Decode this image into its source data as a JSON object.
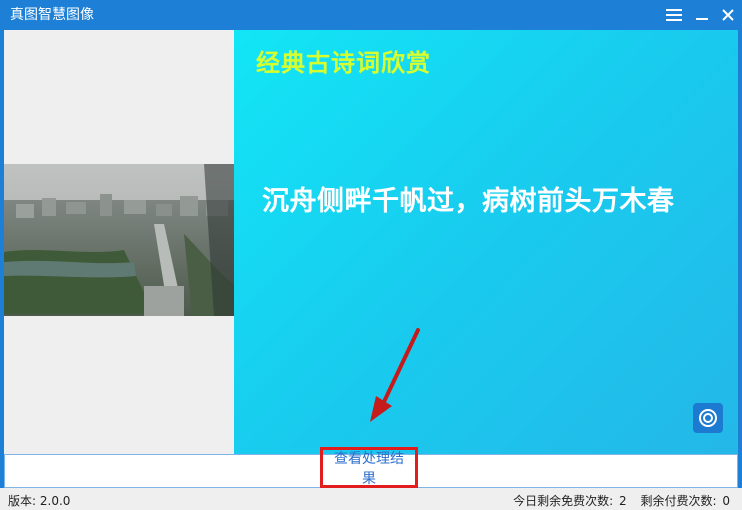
{
  "app": {
    "title": "真图智慧图像"
  },
  "window_controls": {
    "menu_icon": "hamburger-menu-icon",
    "minimize_icon": "minimize-icon",
    "close_icon": "close-icon"
  },
  "poem": {
    "heading": "经典古诗词欣赏",
    "line": "沉舟侧畔千帆过，病树前头万木春"
  },
  "actions": {
    "view_result": "查看处理结果",
    "camera_icon": "camera-icon"
  },
  "status": {
    "version_label": "版本:",
    "version": "2.0.0",
    "free_label": "今日剩余免费次数:",
    "free_count": "2",
    "paid_label": "剩余付费次数:",
    "paid_count": "0"
  },
  "colors": {
    "titlebar": "#1e7fd6",
    "heading": "#d7ff2e",
    "link": "#2e6fcd",
    "highlight": "#e21d1d"
  }
}
